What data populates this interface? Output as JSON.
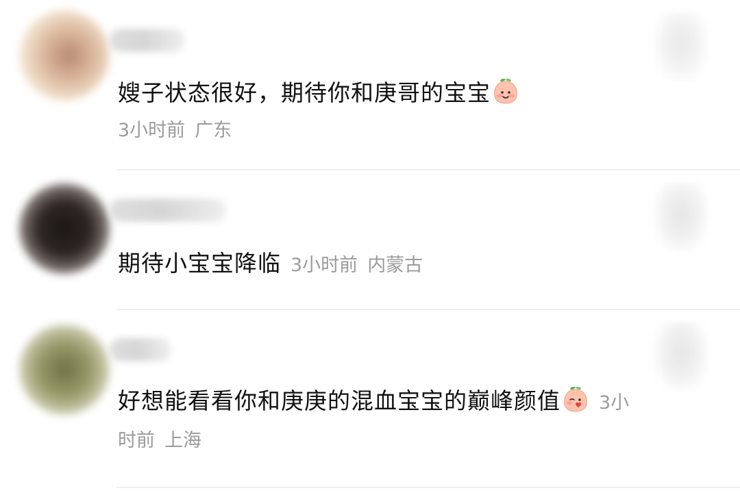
{
  "comments": [
    {
      "text": "嫂子状态很好，期待你和庚哥的宝宝",
      "emoji": "smiling-face-emoji",
      "time": "3小时前",
      "location": "广东"
    },
    {
      "text": "期待小宝宝降临",
      "emoji": "",
      "time": "3小时前",
      "location": "内蒙古"
    },
    {
      "text": "好想能看看你和庚庚的混血宝宝的巅峰颜值",
      "emoji": "blowing-kiss-emoji",
      "time": "3小时前",
      "location": "上海"
    }
  ],
  "icons": {
    "avatar": "avatar-icon",
    "like": "like-icon"
  }
}
